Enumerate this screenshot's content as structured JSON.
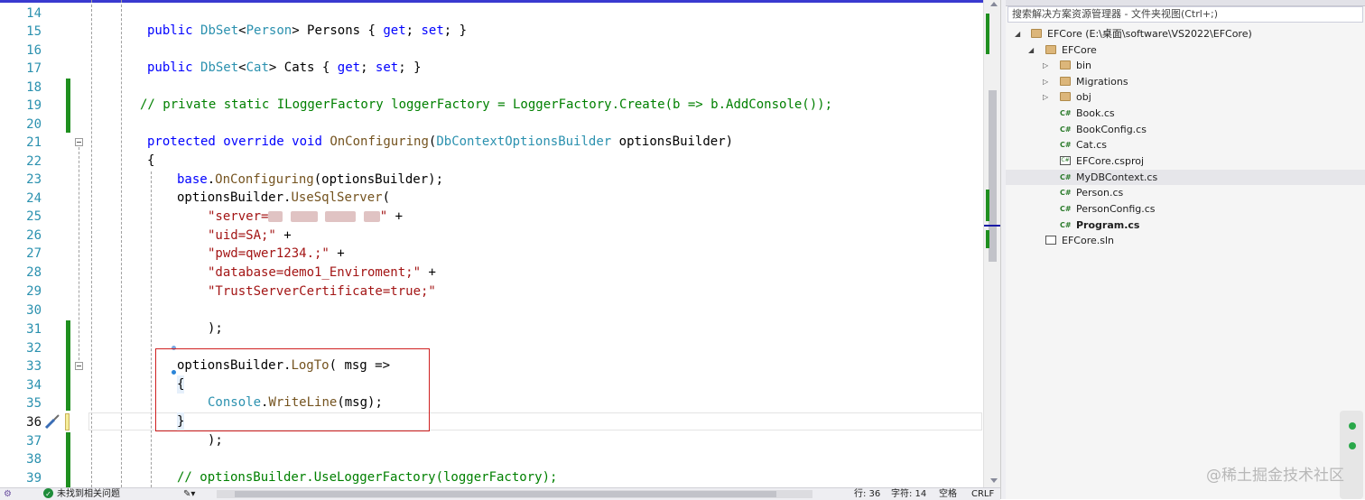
{
  "editor": {
    "line_numbers": [
      "14",
      "15",
      "16",
      "17",
      "18",
      "19",
      "20",
      "21",
      "22",
      "23",
      "24",
      "25",
      "26",
      "27",
      "28",
      "29",
      "30",
      "31",
      "32",
      "33",
      "34",
      "35",
      "36",
      "37",
      "38",
      "39"
    ],
    "lines": {
      "l15": {
        "k1": "public",
        "t1": "DbSet",
        "p1": "<",
        "t2": "Person",
        "p2": "> Persons { ",
        "k2": "get",
        "p3": "; ",
        "k3": "set",
        "p4": "; }"
      },
      "l17": {
        "k1": "public",
        "t1": "DbSet",
        "p1": "<",
        "t2": "Cat",
        "p2": "> Cats { ",
        "k2": "get",
        "p3": "; ",
        "k3": "set",
        "p4": "; }"
      },
      "l19": {
        "comment": "// private static ILoggerFactory loggerFactory = LoggerFactory.Create(b => b.AddConsole());"
      },
      "l21": {
        "k1": "protected",
        "k2": "override",
        "k3": "void",
        "m1": "OnConfiguring",
        "p1": "(",
        "t1": "DbContextOptionsBuilder",
        "p2": " optionsBuilder)"
      },
      "l22": {
        "p1": "{"
      },
      "l23": {
        "k1": "base",
        "p1": ".",
        "m1": "OnConfiguring",
        "p2": "(optionsBuilder);"
      },
      "l24": {
        "p1": "optionsBuilder.",
        "m1": "UseSqlServer",
        "p2": "("
      },
      "l25": {
        "s1": "\"server=",
        "s2": "\"",
        "p1": " +"
      },
      "l26": {
        "s1": "\"uid=SA;\"",
        "p1": " +"
      },
      "l27": {
        "s1": "\"pwd=qwer1234.;\"",
        "p1": " +"
      },
      "l28": {
        "s1": "\"database=demo1_Enviroment;\"",
        "p1": " +"
      },
      "l29": {
        "s1": "\"TrustServerCertificate=true;\""
      },
      "l31": {
        "p1": ");"
      },
      "l33": {
        "p1": "optionsBuilder.",
        "m1": "LogTo",
        "p2": "( msg =>"
      },
      "l34": {
        "p1": "{"
      },
      "l35": {
        "t1": "Console",
        "p1": ".",
        "m1": "WriteLine",
        "p2": "(msg);"
      },
      "l36": {
        "p1": "}"
      },
      "l37": {
        "p1": ");"
      },
      "l39": {
        "comment": "// optionsBuilder.UseLoggerFactory(loggerFactory);"
      }
    }
  },
  "status_bar": {
    "issues_text": "未找到相关问题",
    "line_text": "行: 36",
    "char_text": "字符: 14",
    "spaces_text": "空格",
    "eol_text": "CRLF"
  },
  "solution_explorer": {
    "search_placeholder": "搜索解决方案资源管理器 - 文件夹视图(Ctrl+;)",
    "items": [
      {
        "label": "EFCore (E:\\桌面\\software\\VS2022\\EFCore)",
        "icon": "folder-icon"
      },
      {
        "label": "EFCore",
        "icon": "folder-icon"
      },
      {
        "label": "bin",
        "icon": "folder-icon"
      },
      {
        "label": "Migrations",
        "icon": "folder-icon"
      },
      {
        "label": "obj",
        "icon": "folder-icon"
      },
      {
        "label": "Book.cs",
        "icon": "csharp-file-icon"
      },
      {
        "label": "BookConfig.cs",
        "icon": "csharp-file-icon"
      },
      {
        "label": "Cat.cs",
        "icon": "csharp-file-icon"
      },
      {
        "label": "EFCore.csproj",
        "icon": "csproj-file-icon"
      },
      {
        "label": "MyDBContext.cs",
        "icon": "csharp-file-icon",
        "selected": true
      },
      {
        "label": "Person.cs",
        "icon": "csharp-file-icon"
      },
      {
        "label": "PersonConfig.cs",
        "icon": "csharp-file-icon"
      },
      {
        "label": "Program.cs",
        "icon": "csharp-file-icon",
        "bold": true
      },
      {
        "label": "EFCore.sln",
        "icon": "solution-file-icon"
      }
    ],
    "csharp_badge": "C#",
    "csproj_badge": "C#"
  },
  "watermark": "@稀土掘金技术社区",
  "colors": {
    "keyword": "#0000ff",
    "type": "#2b91af",
    "string": "#a31515",
    "comment": "#008000",
    "highlight_box": "#d02020",
    "change_bar": "#1f8f1f"
  }
}
